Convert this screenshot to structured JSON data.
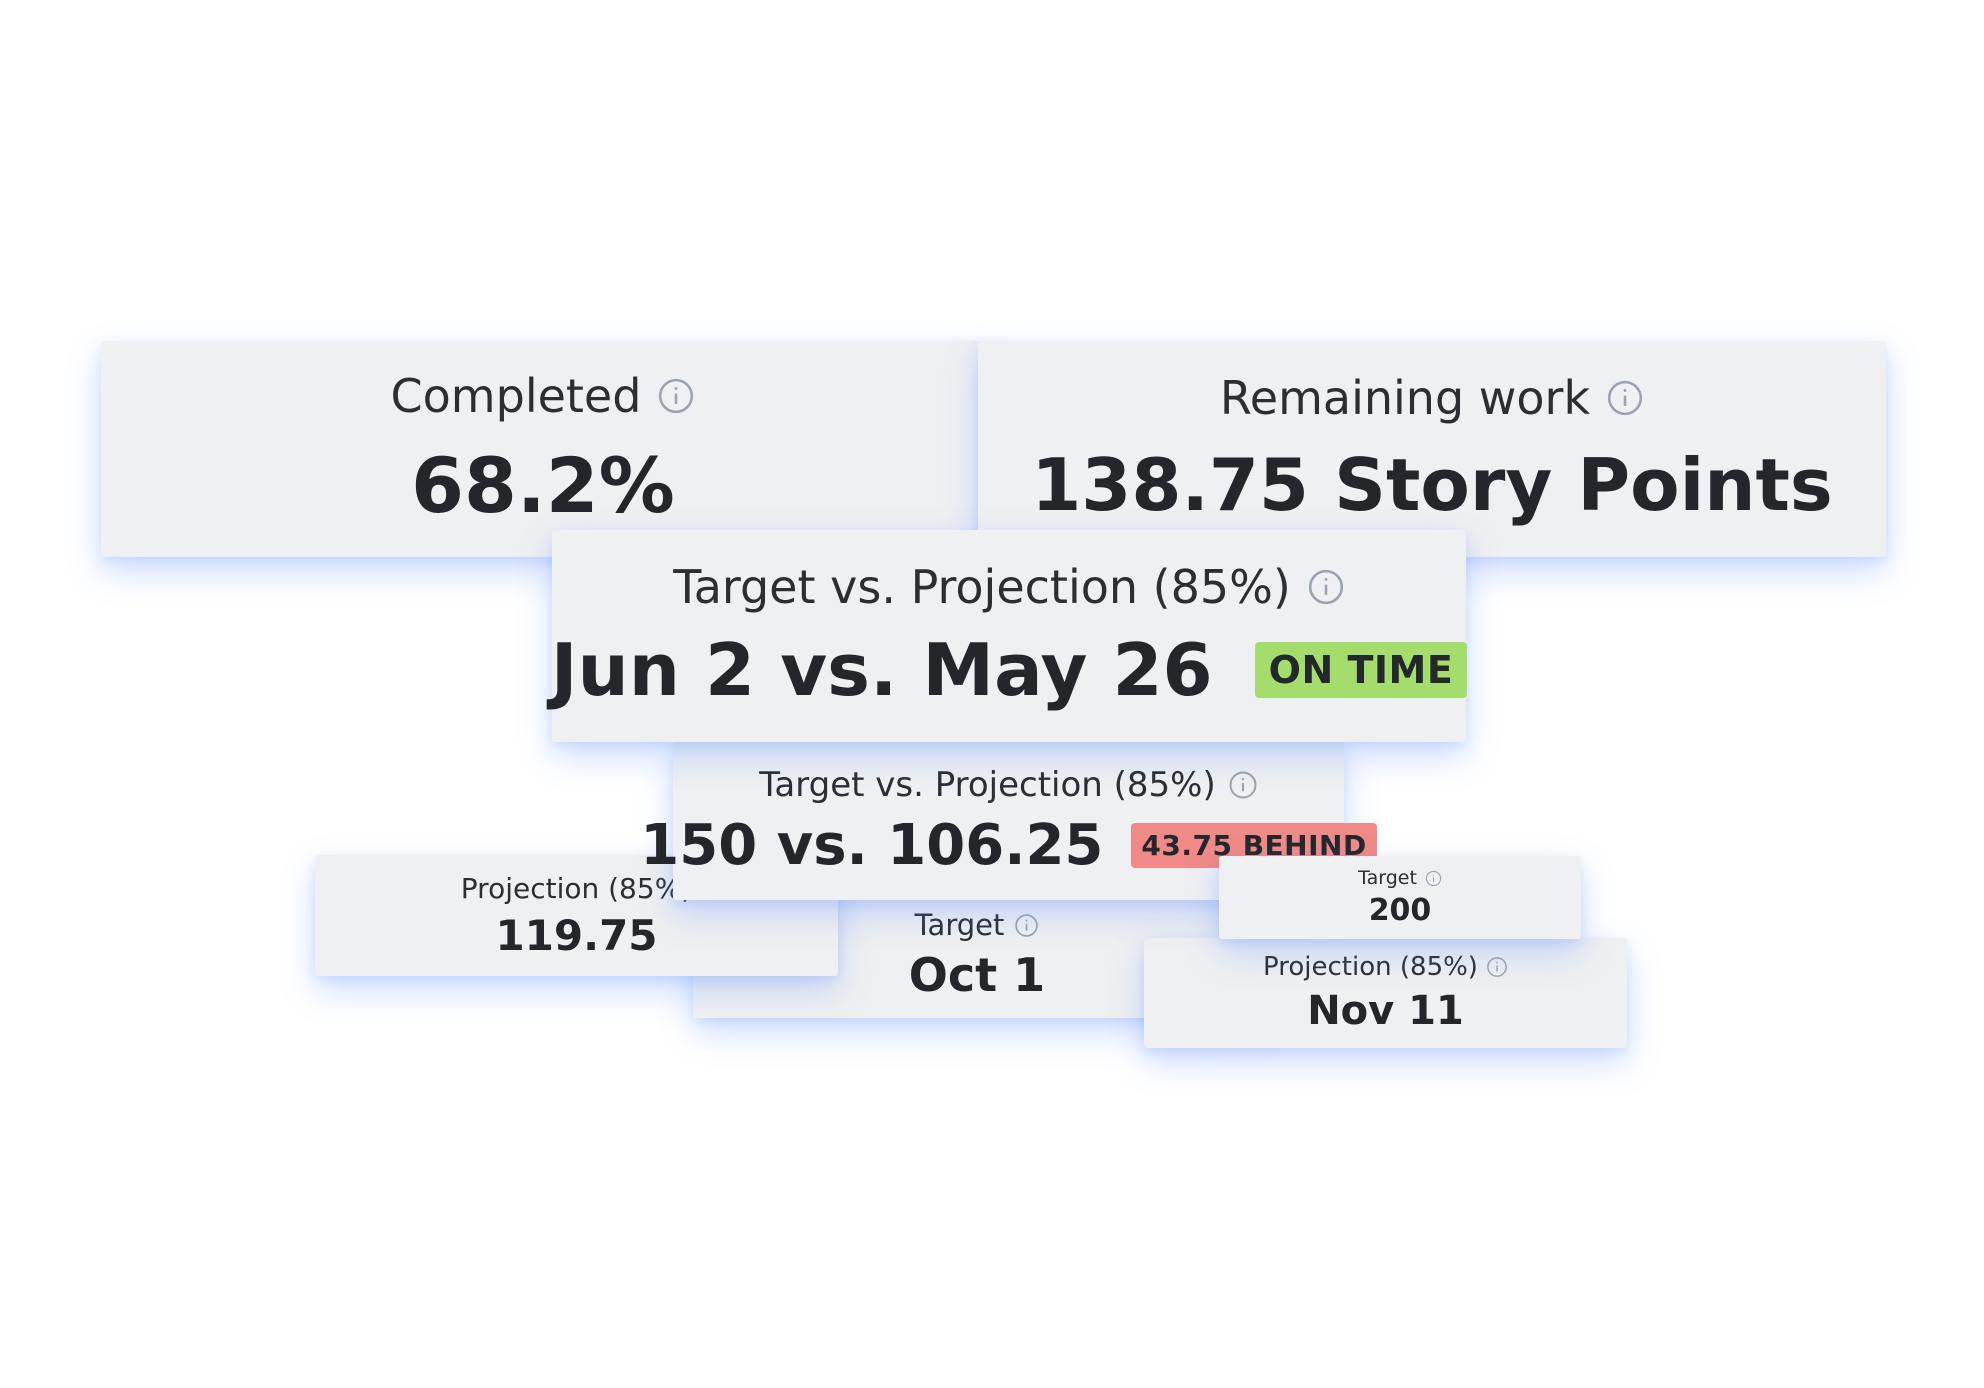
{
  "cards": {
    "completed": {
      "label": "Completed",
      "value": "68.2%",
      "info_icon": "info-circle-icon"
    },
    "remaining": {
      "label": "Remaining work",
      "value": "138.75 Story Points",
      "info_icon": "info-circle-icon"
    },
    "date_comparison": {
      "label": "Target vs. Projection (85%)",
      "value": "Jun 2 vs. May 26",
      "badge": "ON TIME",
      "badge_color": "#a5dd6c",
      "info_icon": "info-circle-icon"
    },
    "points_comparison": {
      "label": "Target vs. Projection (85%)",
      "value": "150 vs. 106.25",
      "badge": "43.75 BEHIND",
      "badge_color": "#f18a86",
      "info_icon": "info-circle-icon"
    },
    "projection_points": {
      "label": "Projection (85%)",
      "value": "119.75"
    },
    "target_date": {
      "label": "Target",
      "value": "Oct 1",
      "info_icon": "info-circle-icon"
    },
    "target_points": {
      "label": "Target",
      "value": "200",
      "info_icon": "info-circle-icon"
    },
    "projection_date": {
      "label": "Projection (85%)",
      "value": "Nov 11",
      "info_icon": "info-circle-icon"
    }
  },
  "colors": {
    "card_background": "#eff0f2",
    "glow": "#588cff",
    "icon": "#9ba2b0",
    "text": "#24272b"
  }
}
